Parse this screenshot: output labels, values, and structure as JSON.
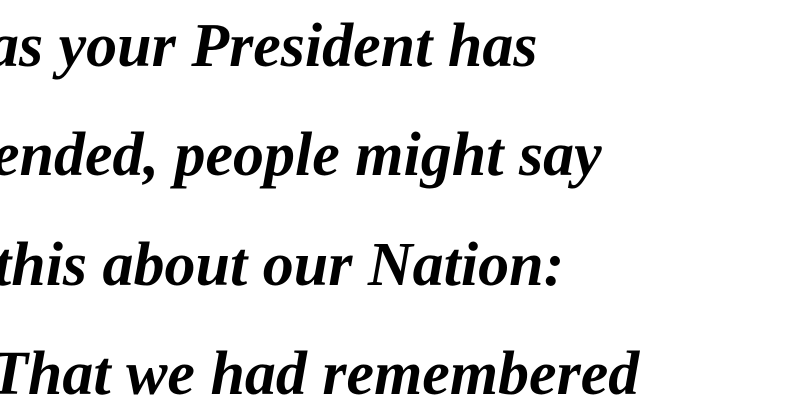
{
  "document": {
    "lines": [
      "as your President has",
      "ended, people might say",
      "this about our Nation:",
      "That we had remembered"
    ]
  },
  "colors": {
    "background": "#ffffff",
    "text": "#000000"
  }
}
